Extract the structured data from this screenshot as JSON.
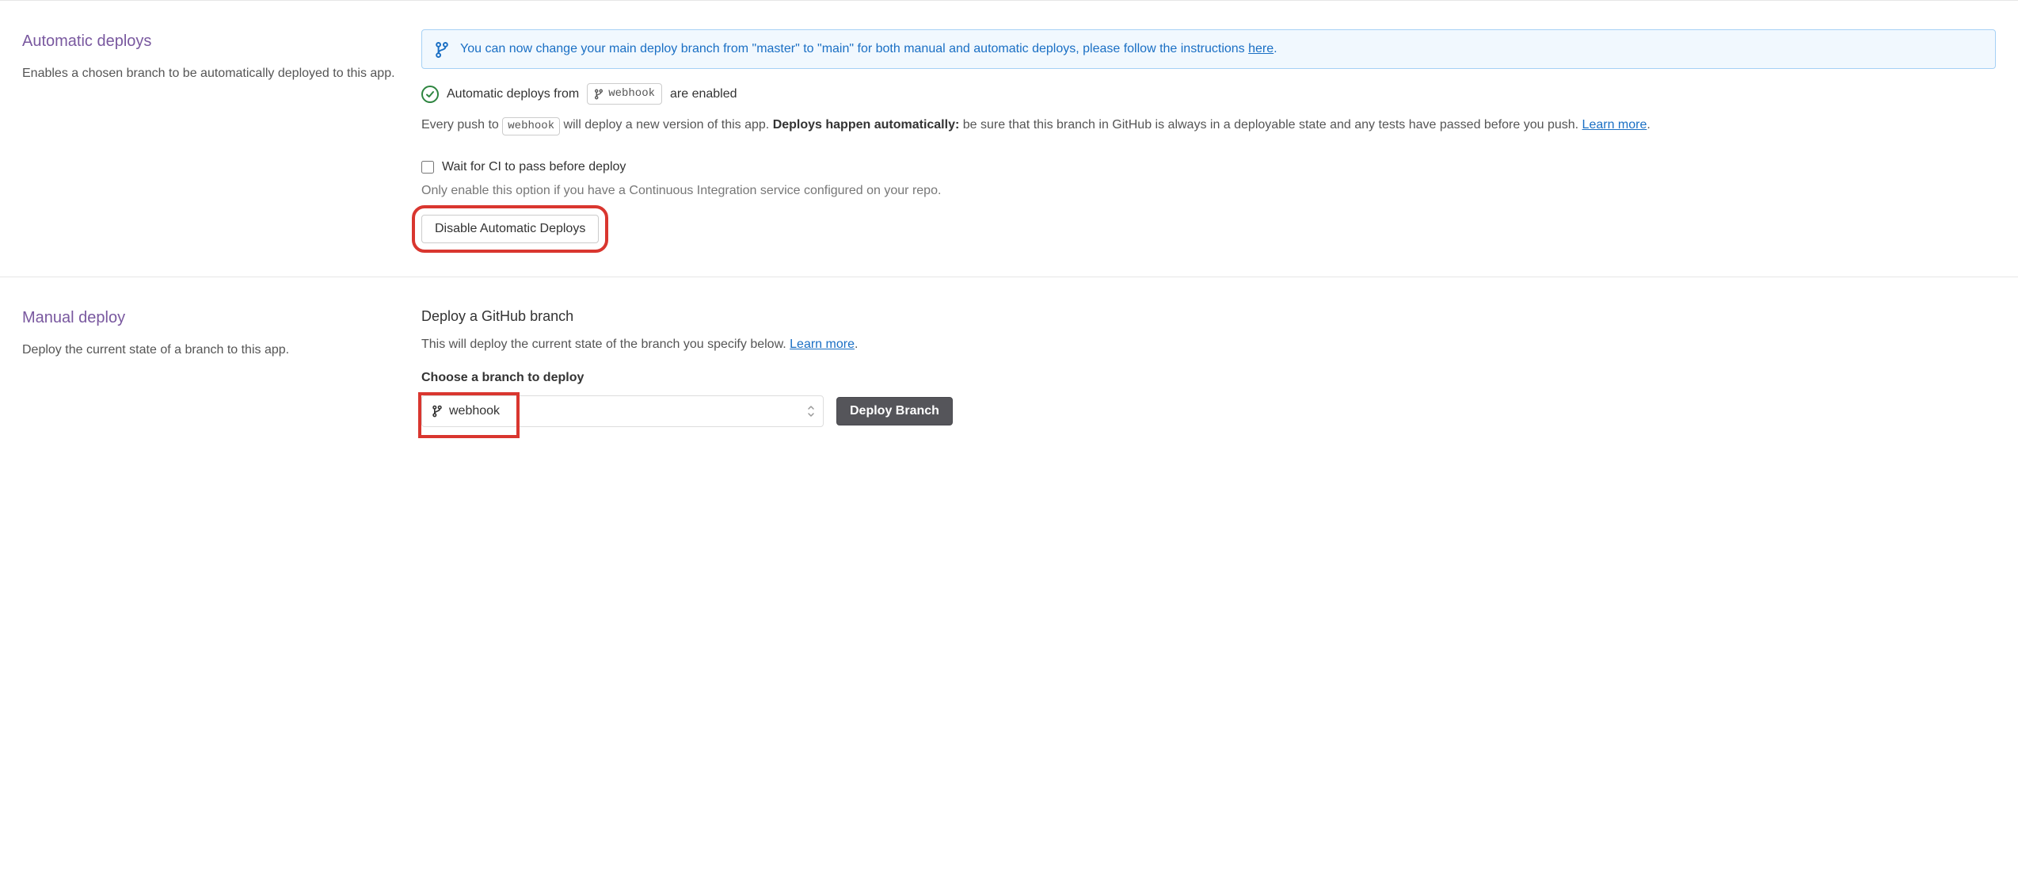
{
  "automatic": {
    "heading": "Automatic deploys",
    "description": "Enables a chosen branch to be automatically deployed to this app.",
    "banner_text_before": "You can now change your main deploy branch from \"master\" to \"main\" for both manual and automatic deploys, please follow the instructions ",
    "banner_link": "here",
    "banner_text_after": ".",
    "status_before": "Automatic deploys from",
    "status_branch": "webhook",
    "status_after": "are enabled",
    "push_before": "Every push to ",
    "push_branch": "webhook",
    "push_after": " will deploy a new version of this app. ",
    "push_bold": "Deploys happen automatically:",
    "push_rest": " be sure that this branch in GitHub is always in a deployable state and any tests have passed before you push. ",
    "learn_more": "Learn more",
    "ci_label": "Wait for CI to pass before deploy",
    "ci_hint": "Only enable this option if you have a Continuous Integration service configured on your repo.",
    "disable_btn": "Disable Automatic Deploys"
  },
  "manual": {
    "heading": "Manual deploy",
    "description": "Deploy the current state of a branch to this app.",
    "sub_heading": "Deploy a GitHub branch",
    "sub_body_before": "This will deploy the current state of the branch you specify below. ",
    "learn_more": "Learn more",
    "choose_label": "Choose a branch to deploy",
    "selected_branch": "webhook",
    "deploy_btn": "Deploy Branch"
  }
}
